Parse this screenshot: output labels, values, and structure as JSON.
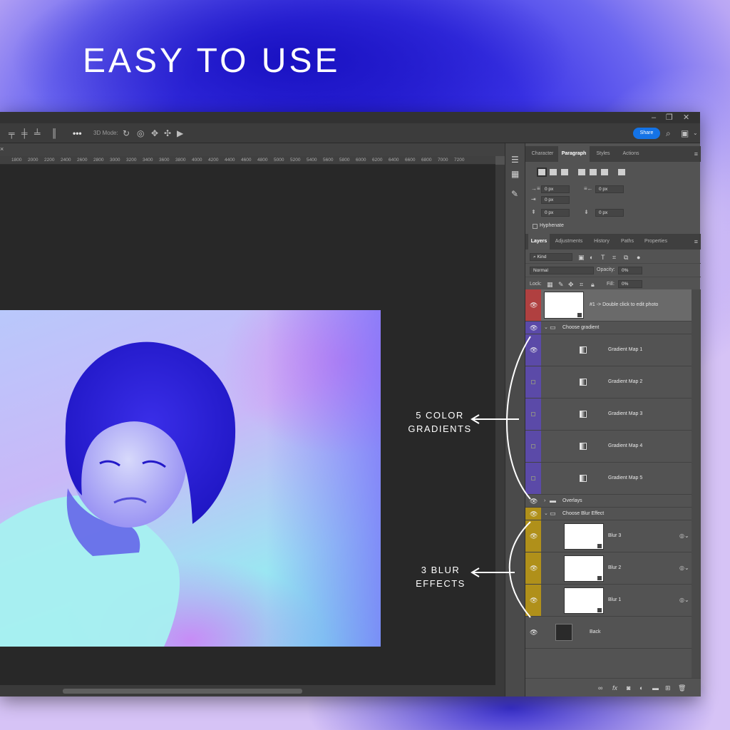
{
  "headline": "EASY TO USE",
  "colors": {
    "share_blue": "#1473e6",
    "layer_red": "#b04040",
    "layer_purple": "#5b4aa8",
    "layer_gold": "#b0901a",
    "canvas_bg": "#282828",
    "panel_bg": "#535353"
  },
  "window": {
    "controls": [
      "–",
      "❐",
      "✕"
    ],
    "options_bar": {
      "mode_label": "3D Mode:",
      "more": "•••",
      "share": "Share"
    }
  },
  "ruler": [
    "1800",
    "2000",
    "2200",
    "2400",
    "2600",
    "2800",
    "3000",
    "3200",
    "3400",
    "3600",
    "3800",
    "4000",
    "4200",
    "4400",
    "4600",
    "4800",
    "5000",
    "5200",
    "5400",
    "5600",
    "5800",
    "6000",
    "6200",
    "6400",
    "6600",
    "6800",
    "7000",
    "7200"
  ],
  "top_panel": {
    "tabs": [
      "Character",
      "Paragraph",
      "Styles",
      "Actions"
    ],
    "active_tab": "Paragraph",
    "indent_left": "0 px",
    "indent_right": "0 px",
    "first_line": "0 px",
    "space_before": "0 px",
    "space_after": "0 px",
    "hyphenate": "Hyphenate"
  },
  "layers_panel": {
    "tabs": [
      "Layers",
      "Adjustments",
      "History",
      "Paths",
      "Properties"
    ],
    "active_tab": "Layers",
    "filter_kind": "Kind",
    "blend_mode": "Normal",
    "opacity_label": "Opacity:",
    "opacity_value": "0%",
    "lock_label": "Lock:",
    "fill_label": "Fill:",
    "fill_value": "0%",
    "layers": [
      {
        "name": "#1 -> Double click to edit photo",
        "kind": "smart-object",
        "visible": true
      },
      {
        "name": "Choose gradient",
        "kind": "group",
        "visible": true
      },
      {
        "name": "Gradient Map 1",
        "kind": "adjustment",
        "visible": true
      },
      {
        "name": "Gradient Map 2",
        "kind": "adjustment",
        "visible": false
      },
      {
        "name": "Gradient Map 3",
        "kind": "adjustment",
        "visible": false
      },
      {
        "name": "Gradient Map 4",
        "kind": "adjustment",
        "visible": false
      },
      {
        "name": "Gradient Map 5",
        "kind": "adjustment",
        "visible": false
      },
      {
        "name": "Overlays",
        "kind": "group",
        "visible": true
      },
      {
        "name": "Choose Blur Effect",
        "kind": "group",
        "visible": true
      },
      {
        "name": "Blur 3",
        "kind": "smart-object",
        "visible": true
      },
      {
        "name": "Blur 2",
        "kind": "smart-object",
        "visible": true
      },
      {
        "name": "Blur 1",
        "kind": "smart-object",
        "visible": true
      },
      {
        "name": "Back",
        "kind": "layer",
        "visible": true
      }
    ]
  },
  "annotations": {
    "gradients_line1": "5 COLOR",
    "gradients_line2": "GRADIENTS",
    "blur_line1": "3 BLUR",
    "blur_line2": "EFFECTS"
  }
}
